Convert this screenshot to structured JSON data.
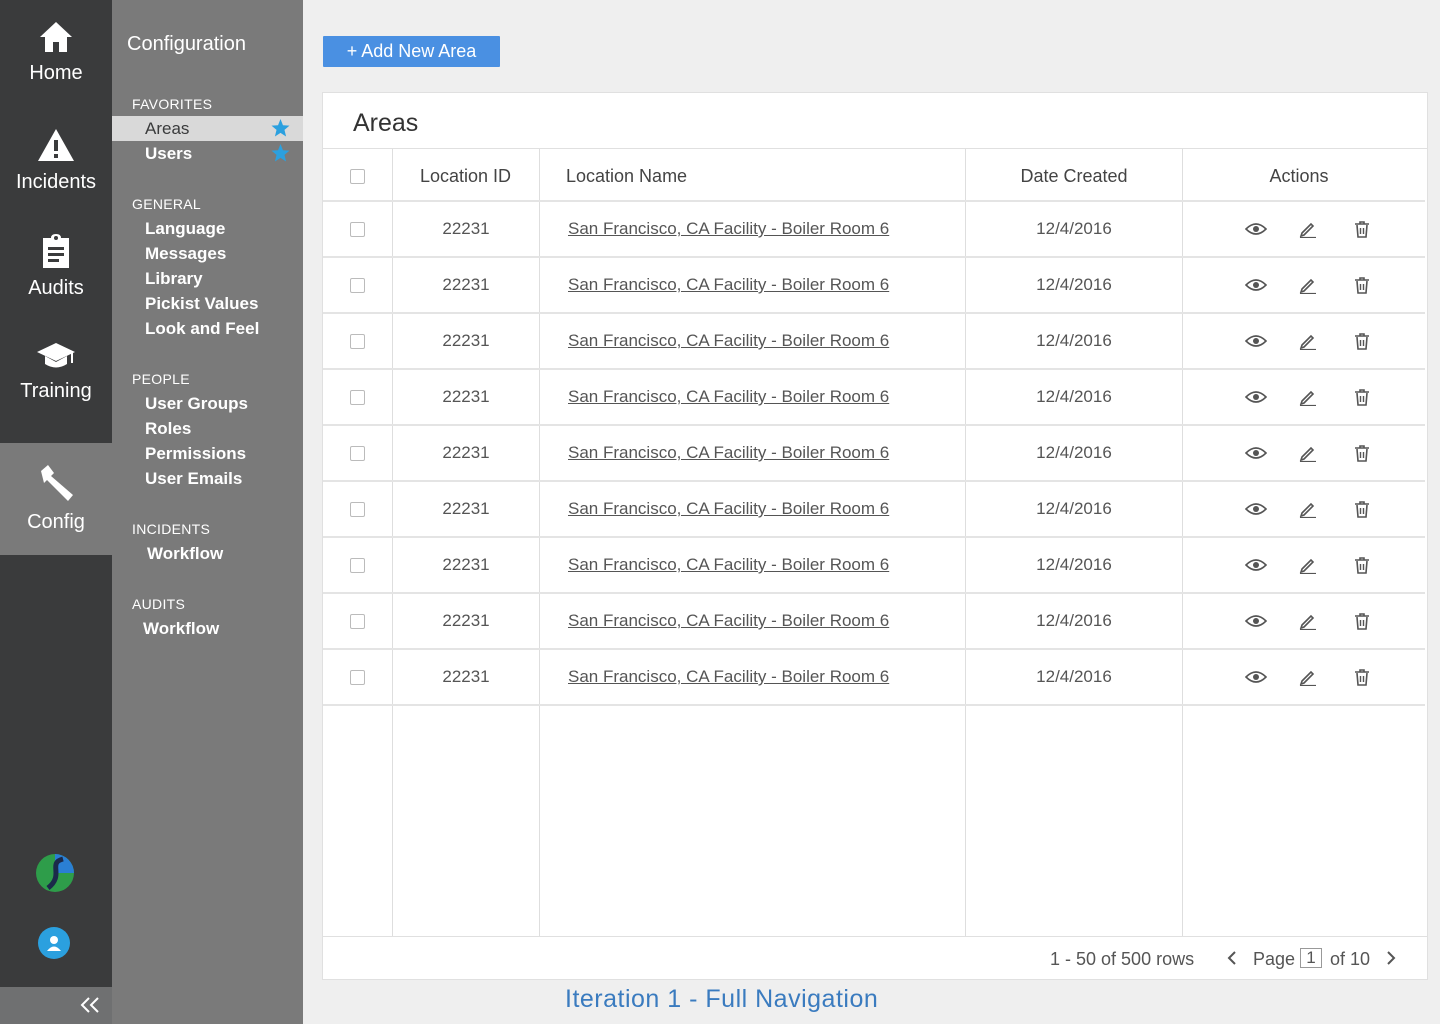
{
  "rail": {
    "items": [
      {
        "label": "Home",
        "icon": "home-icon"
      },
      {
        "label": "Incidents",
        "icon": "warning-icon"
      },
      {
        "label": "Audits",
        "icon": "clipboard-icon"
      },
      {
        "label": "Training",
        "icon": "graduation-cap-icon"
      },
      {
        "label": "Config",
        "icon": "wrench-icon",
        "active": true
      }
    ],
    "collapse_label": "<<"
  },
  "subnav": {
    "title": "Configuration",
    "sections": [
      {
        "header": "FAVORITES",
        "items": [
          {
            "label": "Areas",
            "selected": true,
            "starred": true
          },
          {
            "label": "Users",
            "starred": true
          }
        ]
      },
      {
        "header": "GENERAL",
        "items": [
          {
            "label": "Language"
          },
          {
            "label": "Messages"
          },
          {
            "label": "Library"
          },
          {
            "label": "Pickist Values"
          },
          {
            "label": "Look and Feel"
          }
        ]
      },
      {
        "header": "PEOPLE",
        "items": [
          {
            "label": "User Groups"
          },
          {
            "label": "Roles"
          },
          {
            "label": "Permissions"
          },
          {
            "label": "User Emails"
          }
        ]
      },
      {
        "header": "INCIDENTS",
        "items": [
          {
            "label": "Workflow"
          }
        ]
      },
      {
        "header": "AUDITS",
        "items": [
          {
            "label": "Workflow"
          }
        ]
      }
    ]
  },
  "toolbar": {
    "add_label": "+ Add New Area"
  },
  "panel": {
    "title": "Areas",
    "columns": [
      "Location ID",
      "Location Name",
      "Date Created",
      "Actions"
    ],
    "rows": [
      {
        "id": "22231",
        "name": "San Francisco, CA Facility - Boiler Room 6",
        "date": "12/4/2016"
      },
      {
        "id": "22231",
        "name": "San Francisco, CA Facility - Boiler Room 6",
        "date": "12/4/2016"
      },
      {
        "id": "22231",
        "name": "San Francisco, CA Facility - Boiler Room 6",
        "date": "12/4/2016"
      },
      {
        "id": "22231",
        "name": "San Francisco, CA Facility - Boiler Room 6",
        "date": "12/4/2016"
      },
      {
        "id": "22231",
        "name": "San Francisco, CA Facility - Boiler Room 6",
        "date": "12/4/2016"
      },
      {
        "id": "22231",
        "name": "San Francisco, CA Facility - Boiler Room 6",
        "date": "12/4/2016"
      },
      {
        "id": "22231",
        "name": "San Francisco, CA Facility - Boiler Room 6",
        "date": "12/4/2016"
      },
      {
        "id": "22231",
        "name": "San Francisco, CA Facility - Boiler Room 6",
        "date": "12/4/2016"
      },
      {
        "id": "22231",
        "name": "San Francisco, CA Facility - Boiler Room 6",
        "date": "12/4/2016"
      }
    ],
    "action_icons": [
      "eye-icon",
      "pencil-icon",
      "trash-icon"
    ]
  },
  "pager": {
    "rows_info": "1 - 50 of 500 rows",
    "page_word": "Page",
    "page_value": "1",
    "page_total": "of 10"
  },
  "caption": "Iteration 1 - Full Navigation",
  "colors": {
    "rail": "#3a3b3c",
    "subnav": "#7a7a7a",
    "accent": "#4a90e2",
    "star": "#2ba0df",
    "caption": "#3a7bbf"
  }
}
